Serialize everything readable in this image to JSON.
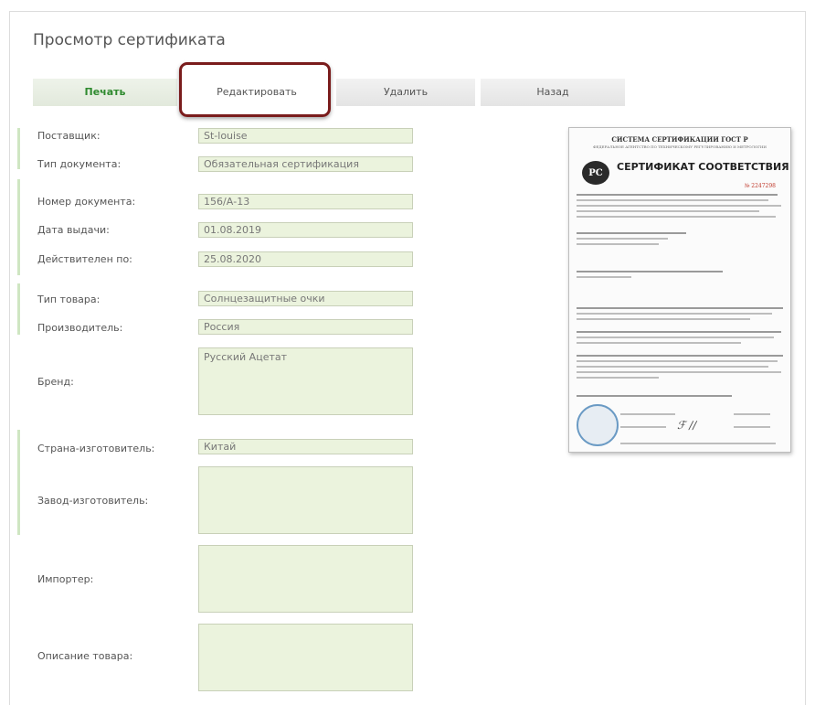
{
  "page": {
    "title": "Просмотр сертификата"
  },
  "tabs": [
    {
      "label": "Печать"
    },
    {
      "label": "Редактировать"
    },
    {
      "label": "Удалить"
    },
    {
      "label": "Назад"
    }
  ],
  "form": {
    "supplier": {
      "label": "Поставщик:",
      "value": "St-louise"
    },
    "doc_type": {
      "label": "Тип документа:",
      "value": "Обязательная сертификация"
    },
    "doc_number": {
      "label": "Номер документа:",
      "value": "156/А-13"
    },
    "issue_date": {
      "label": "Дата выдачи:",
      "value": "01.08.2019"
    },
    "valid_until": {
      "label": "Действителен по:",
      "value": "25.08.2020"
    },
    "product_type": {
      "label": "Тип товара:",
      "value": "Солнцезащитные очки"
    },
    "manufacturer": {
      "label": "Производитель:",
      "value": "Россия"
    },
    "brand": {
      "label": "Бренд:",
      "value": "Русский Ацетат"
    },
    "country": {
      "label": "Страна-изготовитель:",
      "value": "Китай"
    },
    "factory": {
      "label": "Завод-изготовитель:",
      "value": ""
    },
    "importer": {
      "label": "Импортер:",
      "value": ""
    },
    "description": {
      "label": "Описание товара:",
      "value": ""
    }
  },
  "certificate": {
    "header_top": "СИСТЕМА СЕРТИФИКАЦИИ ГОСТ Р",
    "header_sub": "ФЕДЕРАЛЬНОЕ АГЕНТСТВО ПО ТЕХНИЧЕСКОМУ РЕГУЛИРОВАНИЮ И МЕТРОЛОГИИ",
    "logo": "РС",
    "heading": "СЕРТИФИКАТ СООТВЕТСТВИЯ",
    "number": "№ 2247298"
  },
  "colors": {
    "active_tab": "#2f8a2f",
    "field_bg": "#ebf3dd",
    "highlight": "#7a1c1c"
  }
}
